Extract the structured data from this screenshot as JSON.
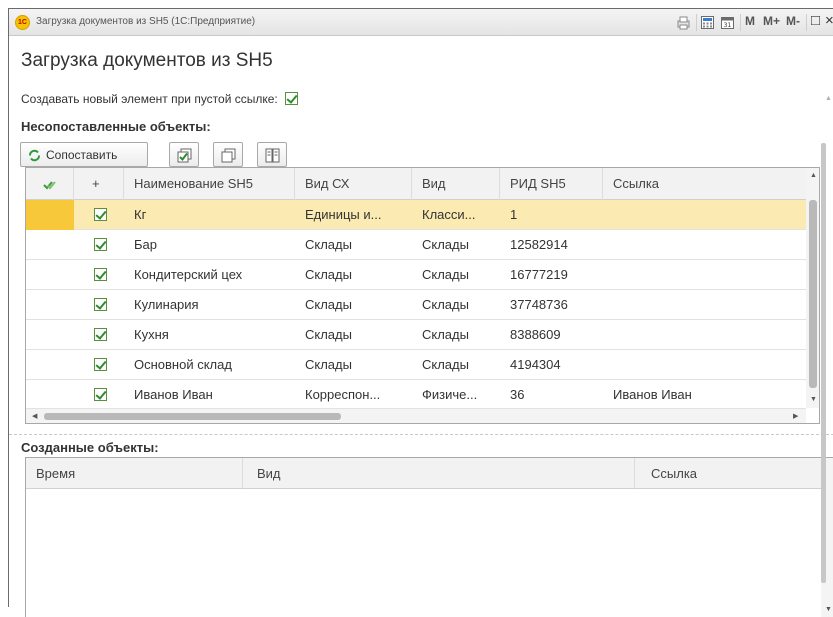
{
  "window": {
    "title": "Загрузка документов из SH5  (1С:Предприятие)",
    "logo_text": "1С",
    "m_label": "M",
    "mplus_label": "M+",
    "mminus_label": "M-",
    "restore_glyph": "□",
    "close_glyph": "×"
  },
  "page": {
    "heading": "Загрузка документов из SH5",
    "option_label": "Создавать новый элемент при пустой ссылке:",
    "option_checked": true
  },
  "unmatched": {
    "section_title": "Несопоставленные объекты:",
    "match_button": "Сопоставить",
    "columns": [
      "",
      "+",
      "Наименование SH5",
      "Вид СХ",
      "Вид",
      "РИД SH5",
      "Ссылка"
    ],
    "rows": [
      {
        "name": "Кг",
        "kind_cx": "Единицы и...",
        "kind": "Класси...",
        "rid": "1",
        "link": "",
        "checked": true,
        "selected": true
      },
      {
        "name": "Бар",
        "kind_cx": "Склады",
        "kind": "Склады",
        "rid": "12582914",
        "link": "",
        "checked": true,
        "selected": false
      },
      {
        "name": "Кондитерский цех",
        "kind_cx": "Склады",
        "kind": "Склады",
        "rid": "16777219",
        "link": "",
        "checked": true,
        "selected": false
      },
      {
        "name": "Кулинария",
        "kind_cx": "Склады",
        "kind": "Склады",
        "rid": "37748736",
        "link": "",
        "checked": true,
        "selected": false
      },
      {
        "name": "Кухня",
        "kind_cx": "Склады",
        "kind": "Склады",
        "rid": "8388609",
        "link": "",
        "checked": true,
        "selected": false
      },
      {
        "name": "Основной склад",
        "kind_cx": "Склады",
        "kind": "Склады",
        "rid": "4194304",
        "link": "",
        "checked": true,
        "selected": false
      },
      {
        "name": "Иванов Иван",
        "kind_cx": "Корреспон...",
        "kind": "Физиче...",
        "rid": "36",
        "link": "Иванов Иван",
        "checked": true,
        "selected": false
      }
    ]
  },
  "created": {
    "section_title": "Созданные объекты:",
    "columns": [
      "Время",
      "Вид",
      "Ссылка"
    ]
  },
  "colors": {
    "selected_row": "#fbeab2",
    "row_cursor": "#f7c93a",
    "check_green": "#2e8b2e"
  }
}
